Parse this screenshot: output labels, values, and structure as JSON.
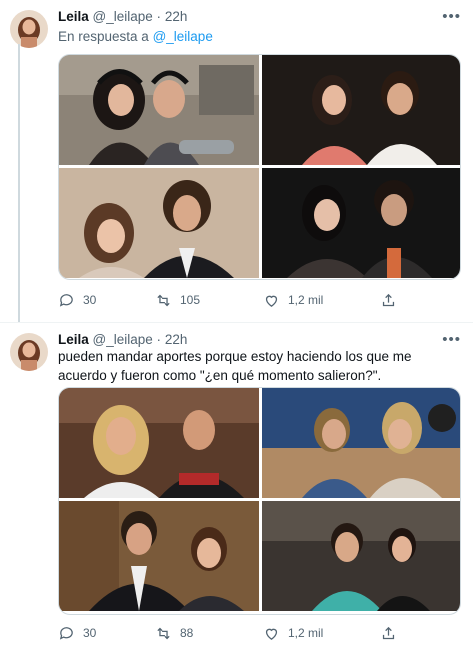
{
  "tweets": [
    {
      "author": {
        "name": "Leila",
        "handle": "@_leilape"
      },
      "dot": "·",
      "time": "22h",
      "reply_prefix": "En respuesta a",
      "reply_to": "@_leilape",
      "text": "",
      "more_icon": "more-dots-icon",
      "stats": {
        "replies": "30",
        "retweets": "105",
        "likes": "1,2 mil"
      }
    },
    {
      "author": {
        "name": "Leila",
        "handle": "@_leilape"
      },
      "dot": "·",
      "time": "22h",
      "text": "pueden mandar aportes porque estoy haciendo los que me acuerdo y fueron como \"¿en qué momento salieron?\".",
      "more_icon": "more-dots-icon",
      "stats": {
        "replies": "30",
        "retweets": "88",
        "likes": "1,2 mil"
      }
    }
  ],
  "colors": {
    "text_primary": "#0f1419",
    "text_secondary": "#536471",
    "link": "#1d9bf0",
    "border": "#cfd9de"
  }
}
